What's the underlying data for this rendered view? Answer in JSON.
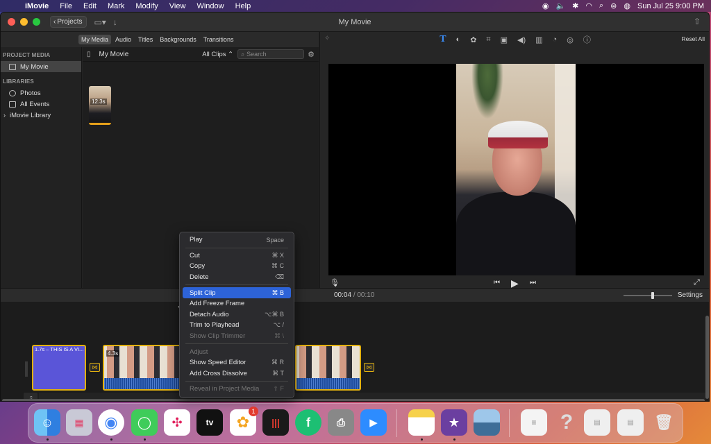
{
  "menubar": {
    "app": "iMovie",
    "items": [
      "File",
      "Edit",
      "Mark",
      "Modify",
      "View",
      "Window",
      "Help"
    ],
    "datetime": "Sun Jul 25  9:00 PM"
  },
  "window": {
    "title": "My Movie",
    "projects_label": "Projects"
  },
  "browser": {
    "tabs": [
      "My Media",
      "Audio",
      "Titles",
      "Backgrounds",
      "Transitions"
    ],
    "active_tab": "My Media",
    "media_title": "My Movie",
    "filter": "All Clips",
    "search_placeholder": "Search",
    "thumb_duration": "12.3s"
  },
  "sidebar": {
    "project_media_header": "PROJECT MEDIA",
    "project_item": "My Movie",
    "libraries_header": "LIBRARIES",
    "items": [
      "Photos",
      "All Events",
      "iMovie Library"
    ]
  },
  "viewer": {
    "reset_label": "Reset All"
  },
  "timeline": {
    "current": "00:04",
    "separator": "/",
    "duration": "00:10",
    "settings_label": "Settings",
    "title_clip_label": "1.7s – THIS IS A VI...",
    "clip_duration": "4.3s"
  },
  "context_menu": {
    "items": [
      {
        "label": "Play",
        "shortcut": "Space",
        "disabled": false
      },
      {
        "label": "Cut",
        "shortcut": "⌘ X",
        "disabled": false
      },
      {
        "label": "Copy",
        "shortcut": "⌘ C",
        "disabled": false
      },
      {
        "label": "Delete",
        "shortcut": "⌫",
        "disabled": false
      },
      {
        "label": "Split Clip",
        "shortcut": "⌘ B",
        "highlighted": true
      },
      {
        "label": "Add Freeze Frame",
        "shortcut": "",
        "disabled": false
      },
      {
        "label": "Detach Audio",
        "shortcut": "⌥⌘ B",
        "disabled": false
      },
      {
        "label": "Trim to Playhead",
        "shortcut": "⌥ /",
        "disabled": false
      },
      {
        "label": "Show Clip Trimmer",
        "shortcut": "⌘ \\",
        "disabled": true
      },
      {
        "label": "Adjust",
        "shortcut": "",
        "disabled": true
      },
      {
        "label": "Show Speed Editor",
        "shortcut": "⌘ R",
        "disabled": false
      },
      {
        "label": "Add Cross Dissolve",
        "shortcut": "⌘ T",
        "disabled": false
      },
      {
        "label": "Reveal in Project Media",
        "shortcut": "⇧ F",
        "disabled": true
      }
    ]
  },
  "dock": {
    "photos_badge": "1",
    "apps": [
      "Finder",
      "Launchpad",
      "Chrome",
      "Messages",
      "Slack",
      "Apple TV",
      "Photos",
      "Voice Memos",
      "Fiverr",
      "Printer",
      "Zoom",
      "Notes",
      "iMovie",
      "Preview",
      "Document",
      "Help",
      "Window 1",
      "Window 2",
      "Trash"
    ]
  },
  "colors": {
    "accent": "#2d63d8",
    "clip_border": "#e3b10f",
    "title_clip": "#5a55d8"
  }
}
